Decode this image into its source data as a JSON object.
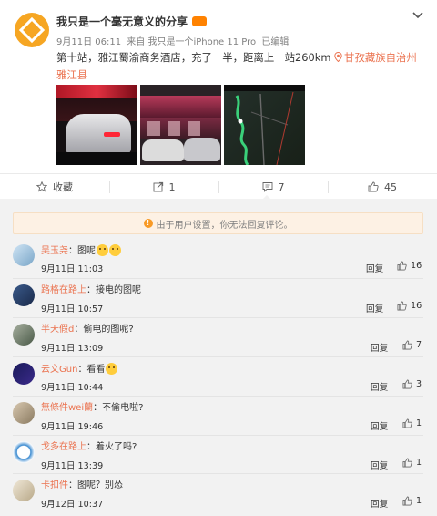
{
  "post": {
    "author": "我只是一个毫无意义的分享",
    "meta": {
      "time": "9月11日 06:11",
      "via": "来自 我只是一个iPhone 11 Pro",
      "edited": "已编辑"
    },
    "text": "第十站，雅江蜀渝商务酒店，充了一半，距离上一站260km",
    "location": "甘孜藏族自治州雅江县",
    "photos": [
      "photo-1",
      "photo-2",
      "photo-3"
    ]
  },
  "actions": {
    "favorite_label": "收藏",
    "repost_count": "1",
    "comment_count": "7",
    "like_count": "45"
  },
  "notice": "由于用户设置，你无法回复评论。",
  "comments": [
    {
      "user": "吴玉尧",
      "text": "：图呢",
      "emoji": true,
      "emoji2": true,
      "time": "9月11日 11:03",
      "reply": "回复",
      "likes": "16"
    },
    {
      "user": "路格在路上",
      "text": "：接电的图呢",
      "time": "9月11日 10:57",
      "reply": "回复",
      "likes": "16"
    },
    {
      "user": "半天假d",
      "text": "：偷电的图呢?",
      "time": "9月11日 13:09",
      "reply": "回复",
      "likes": "7"
    },
    {
      "user": "云文Gun",
      "text": "：看看",
      "emoji": true,
      "time": "9月11日 10:44",
      "reply": "回复",
      "likes": "3"
    },
    {
      "user": "無條件wei蘭",
      "text": "：不偷电啦?",
      "time": "9月11日 19:46",
      "reply": "回复",
      "likes": "1"
    },
    {
      "user": "戈多在路上",
      "text": "：着火了吗?",
      "time": "9月11日 13:39",
      "reply": "回复",
      "likes": "1"
    },
    {
      "user": "卡扣件",
      "text": "：图呢？别怂",
      "time": "9月12日 10:37",
      "reply": "回复",
      "likes": "1"
    }
  ],
  "colors": {
    "accent": "#eb7350",
    "vip": "#ff8200",
    "avatar": "#f6a623",
    "notice_bg": "#fdf1e4"
  }
}
